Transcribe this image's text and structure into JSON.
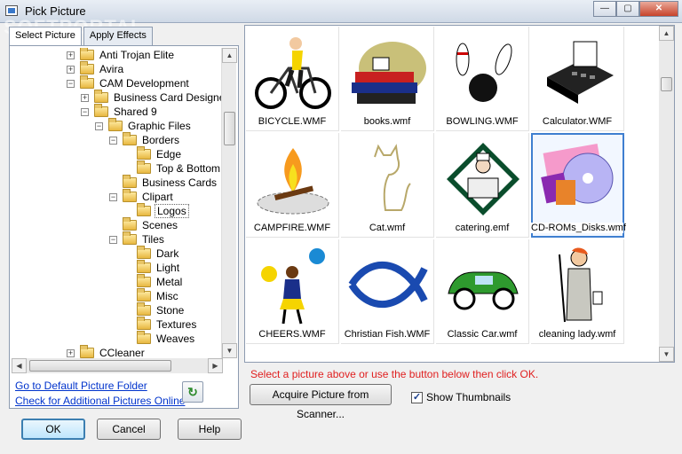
{
  "window": {
    "title": "Pick Picture",
    "icon": "window-icon"
  },
  "watermark": "SOFTPORTAL",
  "title_controls": {
    "minimize": "—",
    "maximize": "▢",
    "close": "✕"
  },
  "tabs": [
    {
      "label": "Select Picture",
      "active": true
    },
    {
      "label": "Apply Effects",
      "active": false
    }
  ],
  "tree": [
    {
      "label": "Anti Trojan Elite",
      "expander": "+",
      "level": 4
    },
    {
      "label": "Avira",
      "expander": "+",
      "level": 4
    },
    {
      "label": "CAM Development",
      "expander": "−",
      "level": 4
    },
    {
      "label": "Business Card Designer",
      "expander": "+",
      "level": 5
    },
    {
      "label": "Shared 9",
      "expander": "−",
      "level": 5
    },
    {
      "label": "Graphic Files",
      "expander": "−",
      "level": 6
    },
    {
      "label": "Borders",
      "expander": "−",
      "level": 7
    },
    {
      "label": "Edge",
      "expander": "",
      "level": 8
    },
    {
      "label": "Top & Bottom",
      "expander": "",
      "level": 8
    },
    {
      "label": "Business Cards",
      "expander": "",
      "level": 7
    },
    {
      "label": "Clipart",
      "expander": "−",
      "level": 7
    },
    {
      "label": "Logos",
      "expander": "",
      "level": 8,
      "selected": true
    },
    {
      "label": "Scenes",
      "expander": "",
      "level": 7
    },
    {
      "label": "Tiles",
      "expander": "−",
      "level": 7
    },
    {
      "label": "Dark",
      "expander": "",
      "level": 8
    },
    {
      "label": "Light",
      "expander": "",
      "level": 8
    },
    {
      "label": "Metal",
      "expander": "",
      "level": 8
    },
    {
      "label": "Misc",
      "expander": "",
      "level": 8
    },
    {
      "label": "Stone",
      "expander": "",
      "level": 8
    },
    {
      "label": "Textures",
      "expander": "",
      "level": 8
    },
    {
      "label": "Weaves",
      "expander": "",
      "level": 8
    },
    {
      "label": "CCleaner",
      "expander": "+",
      "level": 4
    }
  ],
  "links": {
    "default_folder": "Go to Default Picture Folder",
    "additional_online": "Check for Additional Pictures Online"
  },
  "pictures": [
    {
      "name": "BICYCLE.WMF",
      "icon": "bicycle-icon"
    },
    {
      "name": "books.wmf",
      "icon": "books-icon"
    },
    {
      "name": "BOWLING.WMF",
      "icon": "bowling-icon"
    },
    {
      "name": "Calculator.WMF",
      "icon": "calculator-icon"
    },
    {
      "name": "CAMPFIRE.WMF",
      "icon": "campfire-icon"
    },
    {
      "name": "Cat.wmf",
      "icon": "cat-icon"
    },
    {
      "name": "catering.emf",
      "icon": "catering-icon"
    },
    {
      "name": "CD-ROMs_Disks.wmf",
      "icon": "cd-disks-icon",
      "selected": true
    },
    {
      "name": "CHEERS.WMF",
      "icon": "cheerleader-icon"
    },
    {
      "name": "Christian Fish.WMF",
      "icon": "fish-icon"
    },
    {
      "name": "Classic Car.wmf",
      "icon": "car-icon"
    },
    {
      "name": "cleaning lady.wmf",
      "icon": "cleaning-lady-icon"
    }
  ],
  "status_message": "Select a picture above or use  the button below then click OK.",
  "scanner_button": "Acquire Picture from Scanner...",
  "show_thumbnails": {
    "label": "Show Thumbnails",
    "checked": true,
    "mark": "✓"
  },
  "buttons": {
    "ok": "OK",
    "cancel": "Cancel",
    "help": "Help"
  },
  "scroll_glyphs": {
    "up": "▲",
    "down": "▼",
    "left": "◀",
    "right": "▶"
  },
  "refresh_glyph": "↻"
}
